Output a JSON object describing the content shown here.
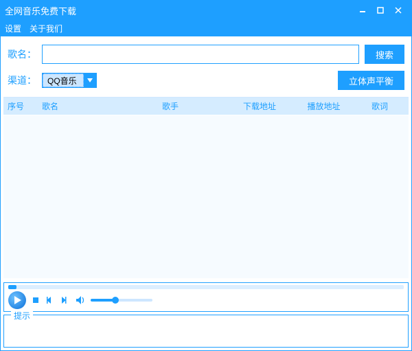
{
  "window": {
    "title": "全网音乐免费下载"
  },
  "menu": {
    "settings": "设置",
    "about": "关于我们"
  },
  "search": {
    "song_label": "歌名：",
    "song_value": "",
    "search_btn": "搜索",
    "channel_label": "渠道：",
    "channel_value": "QQ音乐",
    "balance_btn": "立体声平衡"
  },
  "table": {
    "headers": {
      "index": "序号",
      "name": "歌名",
      "singer": "歌手",
      "download": "下载地址",
      "play": "播放地址",
      "lyric": "歌词"
    },
    "rows": []
  },
  "tip": {
    "label": "提示"
  }
}
